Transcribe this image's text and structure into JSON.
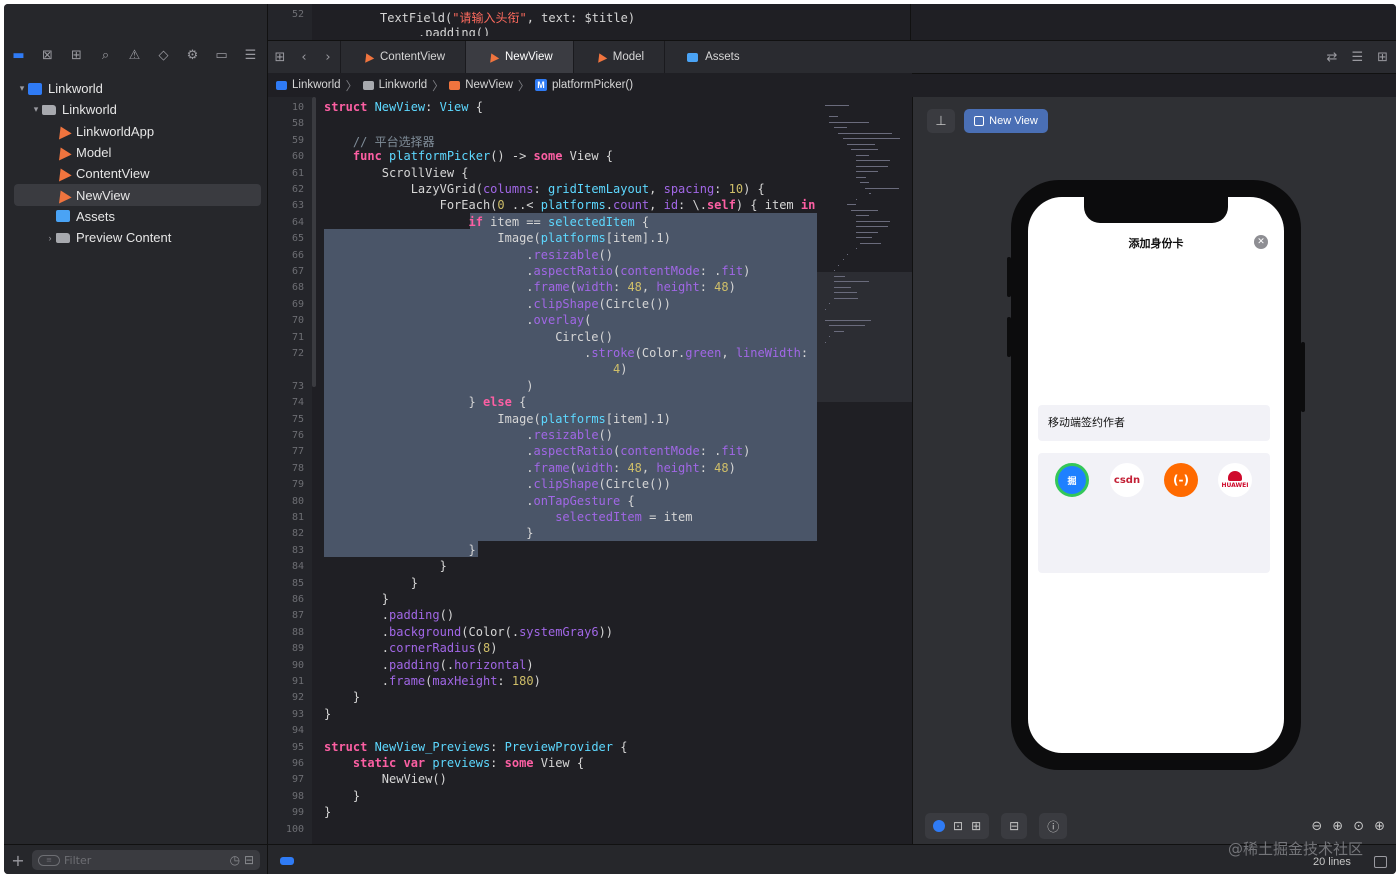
{
  "top_strip": {
    "line_number": "52",
    "code_prefix": "TextField(",
    "code_string": "\"请输入头衔\"",
    "code_suffix": ", text: $title)",
    "code_next": "   .padding()"
  },
  "tabs": [
    {
      "label": "ContentView",
      "icon": "swift-file-icon"
    },
    {
      "label": "NewView",
      "icon": "swift-file-icon",
      "active": true
    },
    {
      "label": "Model",
      "icon": "swift-file-icon"
    },
    {
      "label": "Assets",
      "icon": "assets-icon"
    }
  ],
  "breadcrumb": [
    "Linkworld",
    "Linkworld",
    "NewView",
    "platformPicker()"
  ],
  "breadcrumb_badge": "M",
  "sidebar": {
    "items": [
      {
        "label": "Linkworld",
        "icon": "project-icon",
        "level": 0,
        "disclosure": "▾"
      },
      {
        "label": "Linkworld",
        "icon": "folder-icon",
        "level": 1,
        "disclosure": "▾"
      },
      {
        "label": "LinkworldApp",
        "icon": "swift-file-icon",
        "level": 2
      },
      {
        "label": "Model",
        "icon": "swift-file-icon",
        "level": 2
      },
      {
        "label": "ContentView",
        "icon": "swift-file-icon",
        "level": 2
      },
      {
        "label": "NewView",
        "icon": "swift-file-icon",
        "level": 2,
        "selected": true
      },
      {
        "label": "Assets",
        "icon": "assets-icon",
        "level": 2
      },
      {
        "label": "Preview Content",
        "icon": "folder-icon",
        "level": 2,
        "disclosure": "›"
      }
    ],
    "filter_placeholder": "Filter"
  },
  "code_lines": [
    {
      "n": "10",
      "t": [
        [
          "kw",
          "struct "
        ],
        [
          "ty",
          "NewView"
        ],
        [
          "pl",
          ": "
        ],
        [
          "ty",
          "View"
        ],
        [
          "pl",
          " {"
        ]
      ]
    },
    {
      "n": "58",
      "t": []
    },
    {
      "n": "59",
      "t": [
        [
          "cm",
          "    // 平台选择器"
        ]
      ]
    },
    {
      "n": "60",
      "t": [
        [
          "kw",
          "    func "
        ],
        [
          "ty",
          "platformPicker"
        ],
        [
          "pl",
          "() -> "
        ],
        [
          "kw",
          "some "
        ],
        [
          "pl",
          "View {"
        ]
      ]
    },
    {
      "n": "61",
      "t": [
        [
          "pl",
          "        ScrollView {"
        ]
      ]
    },
    {
      "n": "62",
      "t": [
        [
          "pl",
          "            LazyVGrid("
        ],
        [
          "fn",
          "columns"
        ],
        [
          "pl",
          ": "
        ],
        [
          "ty",
          "gridItemLayout"
        ],
        [
          "pl",
          ", "
        ],
        [
          "fn",
          "spacing"
        ],
        [
          "pl",
          ": "
        ],
        [
          "num",
          "10"
        ],
        [
          "pl",
          ") {"
        ]
      ]
    },
    {
      "n": "63",
      "t": [
        [
          "pl",
          "                ForEach("
        ],
        [
          "num",
          "0"
        ],
        [
          "pl",
          " ..< "
        ],
        [
          "ty",
          "platforms"
        ],
        [
          "pl",
          "."
        ],
        [
          "fn",
          "count"
        ],
        [
          "pl",
          ", "
        ],
        [
          "fn",
          "id"
        ],
        [
          "pl",
          ": \\."
        ],
        [
          "kw",
          "self"
        ],
        [
          "pl",
          ") { item "
        ],
        [
          "kw",
          "in"
        ]
      ]
    },
    {
      "n": "64",
      "t": [
        [
          "kw",
          "                    if "
        ],
        [
          "pl",
          "item == "
        ],
        [
          "ty",
          "selectedItem"
        ],
        [
          "pl",
          " {"
        ]
      ]
    },
    {
      "n": "65",
      "t": [
        [
          "pl",
          "                        Image("
        ],
        [
          "ty",
          "platforms"
        ],
        [
          "pl",
          "[item].1)"
        ]
      ]
    },
    {
      "n": "66",
      "t": [
        [
          "pl",
          "                            ."
        ],
        [
          "fn",
          "resizable"
        ],
        [
          "pl",
          "()"
        ]
      ]
    },
    {
      "n": "67",
      "t": [
        [
          "pl",
          "                            ."
        ],
        [
          "fn",
          "aspectRatio"
        ],
        [
          "pl",
          "("
        ],
        [
          "fn",
          "contentMode"
        ],
        [
          "pl",
          ": ."
        ],
        [
          "fn",
          "fit"
        ],
        [
          "pl",
          ")"
        ]
      ]
    },
    {
      "n": "68",
      "t": [
        [
          "pl",
          "                            ."
        ],
        [
          "fn",
          "frame"
        ],
        [
          "pl",
          "("
        ],
        [
          "fn",
          "width"
        ],
        [
          "pl",
          ": "
        ],
        [
          "num",
          "48"
        ],
        [
          "pl",
          ", "
        ],
        [
          "fn",
          "height"
        ],
        [
          "pl",
          ": "
        ],
        [
          "num",
          "48"
        ],
        [
          "pl",
          ")"
        ]
      ]
    },
    {
      "n": "69",
      "t": [
        [
          "pl",
          "                            ."
        ],
        [
          "fn",
          "clipShape"
        ],
        [
          "pl",
          "(Circle())"
        ]
      ]
    },
    {
      "n": "70",
      "t": [
        [
          "pl",
          "                            ."
        ],
        [
          "fn",
          "overlay"
        ],
        [
          "pl",
          "("
        ]
      ]
    },
    {
      "n": "71",
      "t": [
        [
          "pl",
          "                                Circle()"
        ]
      ]
    },
    {
      "n": "72",
      "t": [
        [
          "pl",
          "                                    ."
        ],
        [
          "fn",
          "stroke"
        ],
        [
          "pl",
          "(Color."
        ],
        [
          "fn",
          "green"
        ],
        [
          "pl",
          ", "
        ],
        [
          "fn",
          "lineWidth"
        ],
        [
          "pl",
          ":"
        ]
      ]
    },
    {
      "n": "",
      "t": [
        [
          "pl",
          "                                        "
        ],
        [
          "num",
          "4"
        ],
        [
          "pl",
          ")"
        ]
      ]
    },
    {
      "n": "73",
      "t": [
        [
          "pl",
          "                            )"
        ]
      ]
    },
    {
      "n": "74",
      "t": [
        [
          "pl",
          "                    } "
        ],
        [
          "kw",
          "else"
        ],
        [
          "pl",
          " {"
        ]
      ]
    },
    {
      "n": "75",
      "t": [
        [
          "pl",
          "                        Image("
        ],
        [
          "ty",
          "platforms"
        ],
        [
          "pl",
          "[item].1)"
        ]
      ]
    },
    {
      "n": "76",
      "t": [
        [
          "pl",
          "                            ."
        ],
        [
          "fn",
          "resizable"
        ],
        [
          "pl",
          "()"
        ]
      ]
    },
    {
      "n": "77",
      "t": [
        [
          "pl",
          "                            ."
        ],
        [
          "fn",
          "aspectRatio"
        ],
        [
          "pl",
          "("
        ],
        [
          "fn",
          "contentMode"
        ],
        [
          "pl",
          ": ."
        ],
        [
          "fn",
          "fit"
        ],
        [
          "pl",
          ")"
        ]
      ]
    },
    {
      "n": "78",
      "t": [
        [
          "pl",
          "                            ."
        ],
        [
          "fn",
          "frame"
        ],
        [
          "pl",
          "("
        ],
        [
          "fn",
          "width"
        ],
        [
          "pl",
          ": "
        ],
        [
          "num",
          "48"
        ],
        [
          "pl",
          ", "
        ],
        [
          "fn",
          "height"
        ],
        [
          "pl",
          ": "
        ],
        [
          "num",
          "48"
        ],
        [
          "pl",
          ")"
        ]
      ]
    },
    {
      "n": "79",
      "t": [
        [
          "pl",
          "                            ."
        ],
        [
          "fn",
          "clipShape"
        ],
        [
          "pl",
          "(Circle())"
        ]
      ]
    },
    {
      "n": "80",
      "t": [
        [
          "pl",
          "                            ."
        ],
        [
          "fn",
          "onTapGesture"
        ],
        [
          "pl",
          " {"
        ]
      ]
    },
    {
      "n": "81",
      "t": [
        [
          "pl",
          "                                "
        ],
        [
          "fn",
          "selectedItem"
        ],
        [
          "pl",
          " = item"
        ]
      ]
    },
    {
      "n": "82",
      "t": [
        [
          "pl",
          "                            }"
        ]
      ]
    },
    {
      "n": "83",
      "t": [
        [
          "pl",
          "                    }"
        ]
      ]
    },
    {
      "n": "84",
      "t": [
        [
          "pl",
          "                }"
        ]
      ]
    },
    {
      "n": "85",
      "t": [
        [
          "pl",
          "            }"
        ]
      ]
    },
    {
      "n": "86",
      "t": [
        [
          "pl",
          "        }"
        ]
      ]
    },
    {
      "n": "87",
      "t": [
        [
          "pl",
          "        ."
        ],
        [
          "fn",
          "padding"
        ],
        [
          "pl",
          "()"
        ]
      ]
    },
    {
      "n": "88",
      "t": [
        [
          "pl",
          "        ."
        ],
        [
          "fn",
          "background"
        ],
        [
          "pl",
          "(Color(."
        ],
        [
          "fn",
          "systemGray6"
        ],
        [
          "pl",
          "))"
        ]
      ]
    },
    {
      "n": "89",
      "t": [
        [
          "pl",
          "        ."
        ],
        [
          "fn",
          "cornerRadius"
        ],
        [
          "pl",
          "("
        ],
        [
          "num",
          "8"
        ],
        [
          "pl",
          ")"
        ]
      ]
    },
    {
      "n": "90",
      "t": [
        [
          "pl",
          "        ."
        ],
        [
          "fn",
          "padding"
        ],
        [
          "pl",
          "(."
        ],
        [
          "fn",
          "horizontal"
        ],
        [
          "pl",
          ")"
        ]
      ]
    },
    {
      "n": "91",
      "t": [
        [
          "pl",
          "        ."
        ],
        [
          "fn",
          "frame"
        ],
        [
          "pl",
          "("
        ],
        [
          "fn",
          "maxHeight"
        ],
        [
          "pl",
          ": "
        ],
        [
          "num",
          "180"
        ],
        [
          "pl",
          ")"
        ]
      ]
    },
    {
      "n": "92",
      "t": [
        [
          "pl",
          "    }"
        ]
      ]
    },
    {
      "n": "93",
      "t": [
        [
          "pl",
          "}"
        ]
      ]
    },
    {
      "n": "94",
      "t": []
    },
    {
      "n": "95",
      "t": [
        [
          "kw",
          "struct "
        ],
        [
          "ty",
          "NewView_Previews"
        ],
        [
          "pl",
          ": "
        ],
        [
          "ty",
          "PreviewProvider"
        ],
        [
          "pl",
          " {"
        ]
      ]
    },
    {
      "n": "96",
      "t": [
        [
          "kw",
          "    static var "
        ],
        [
          "ty",
          "previews"
        ],
        [
          "pl",
          ": "
        ],
        [
          "kw",
          "some "
        ],
        [
          "pl",
          "View {"
        ]
      ]
    },
    {
      "n": "97",
      "t": [
        [
          "pl",
          "        NewView()"
        ]
      ]
    },
    {
      "n": "98",
      "t": [
        [
          "pl",
          "    }"
        ]
      ]
    },
    {
      "n": "99",
      "t": [
        [
          "pl",
          "}"
        ]
      ]
    },
    {
      "n": "100",
      "t": []
    }
  ],
  "preview": {
    "button_label": "New View",
    "sheet_title": "添加身份卡",
    "close_glyph": "✕",
    "name_field": "移动端签约作者",
    "platforms": [
      {
        "label": "掘",
        "icon": "juejin-logo-icon",
        "selected": true
      },
      {
        "label": "csdn",
        "icon": "csdn-logo-icon"
      },
      {
        "label": "(-)",
        "icon": "aliyun-logo-icon"
      },
      {
        "label": "HUAWEI",
        "icon": "huawei-logo-icon"
      }
    ]
  },
  "status": {
    "line_count": "20 lines",
    "watermark": "@稀土掘金技术社区"
  },
  "colors": {
    "selection": "#4a5568",
    "accent": "#2f7bf5",
    "swift": "#f0743e",
    "keyword": "#fc5fa3"
  }
}
